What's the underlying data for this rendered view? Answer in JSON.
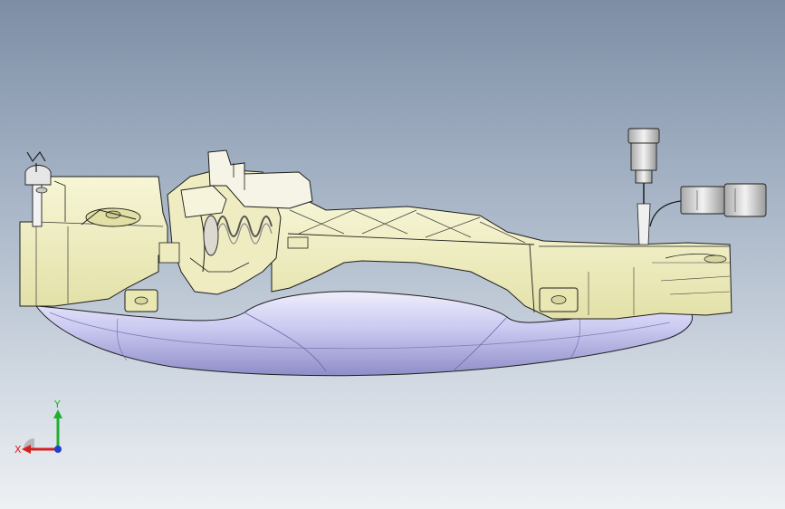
{
  "viewport": {
    "background_top": "#7d8ea5",
    "background_bottom": "#eef1f4",
    "model_colors": {
      "housing": "#f1f0c4",
      "housing_edge": "#1e1e1e",
      "handle": "#c7c6ee",
      "handle_shadow": "#8e8cc6",
      "connector": "#dcdcdc"
    }
  },
  "triad": {
    "x_label": "X",
    "y_label": "Y",
    "x_color": "#d42020",
    "y_color": "#20b030",
    "z_color": "#2040d0"
  }
}
